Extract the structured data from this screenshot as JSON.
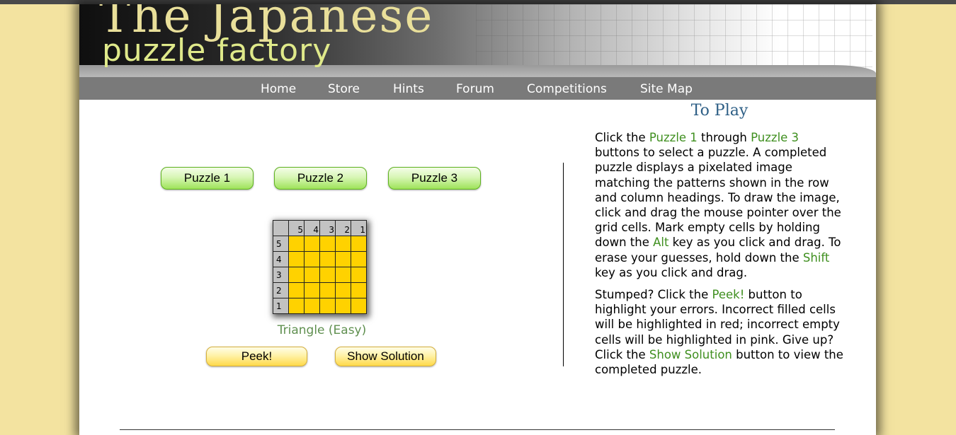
{
  "banner": {
    "title_line1": "The Japanese",
    "title_line2": "puzzle factory"
  },
  "nav": {
    "items": [
      "Home",
      "Store",
      "Hints",
      "Forum",
      "Competitions",
      "Site Map"
    ]
  },
  "puzzle_buttons": [
    "Puzzle 1",
    "Puzzle 2",
    "Puzzle 3"
  ],
  "grid": {
    "column_headings": [
      "5",
      "4",
      "3",
      "2",
      "1"
    ],
    "row_headings": [
      "5",
      "4",
      "3",
      "2",
      "1"
    ],
    "cell_color": "#ffd200"
  },
  "puzzle_caption": "Triangle (Easy)",
  "action_buttons": {
    "peek": "Peek!",
    "show_solution": "Show Solution"
  },
  "instructions": {
    "heading": "To Play",
    "p1": {
      "t1": "Click the ",
      "h1": "Puzzle 1",
      "t2": " through ",
      "h2": "Puzzle 3",
      "t3": " buttons to select a puzzle. A completed puzzle displays a pixelated image matching the patterns shown in the row and column headings. To draw the image, click and drag the mouse pointer over the grid cells. Mark empty cells by holding down the ",
      "h3": "Alt",
      "t4": " key as you click and drag. To erase your guesses, hold down the ",
      "h4": "Shift",
      "t5": " key as you click and drag."
    },
    "p2": {
      "t1": "Stumped? Click the ",
      "h1": "Peek!",
      "t2": " button to highlight your errors. Incorrect filled cells will be highlighted in red; incorrect empty cells will be highlighted in pink. Give up? Click the ",
      "h2": "Show Solution",
      "t3": " button to view the completed puzzle."
    }
  },
  "colors": {
    "page_background": "#f3e3a0",
    "nav_background": "#7a7a7a",
    "highlight_text": "#3f8f1f",
    "heading_text": "#2e5f86"
  }
}
